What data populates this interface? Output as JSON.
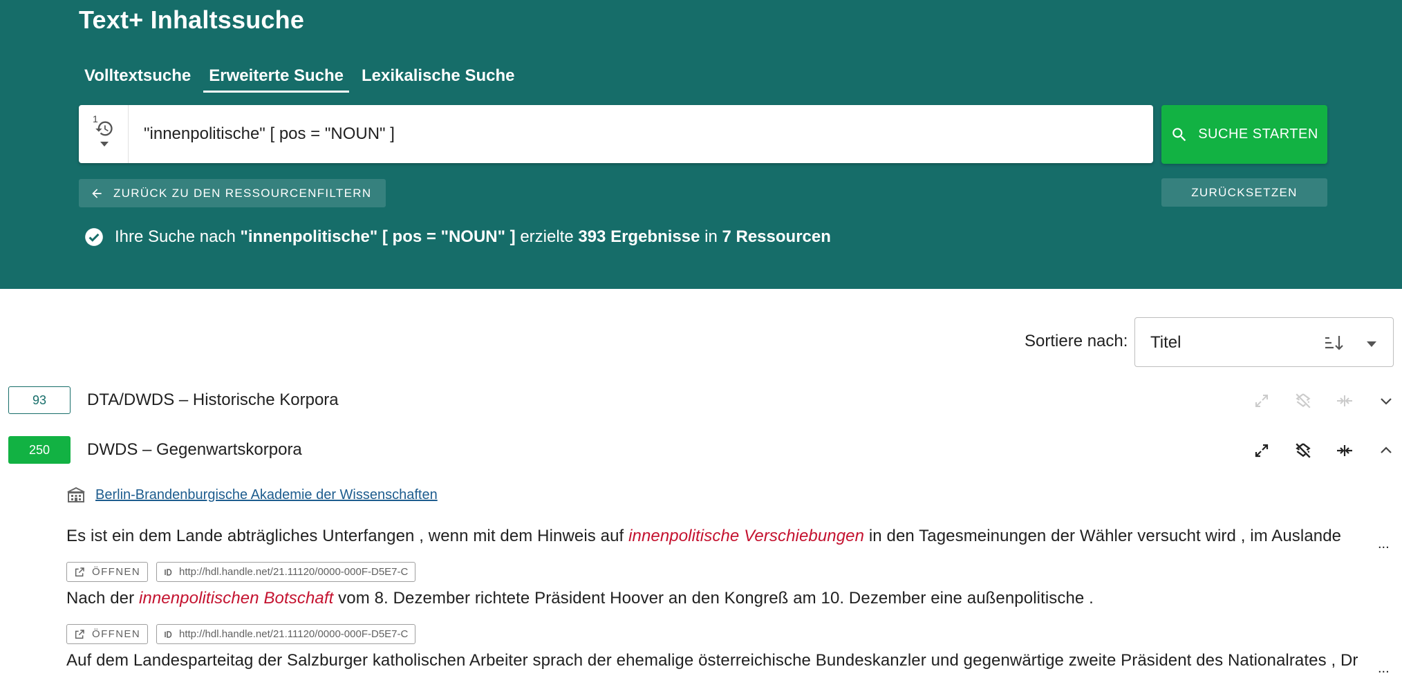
{
  "app": {
    "title": "Text+ Inhaltssuche"
  },
  "tabs": [
    {
      "label": "Volltextsuche",
      "active": false
    },
    {
      "label": "Erweiterte Suche",
      "active": true
    },
    {
      "label": "Lexikalische Suche",
      "active": false
    }
  ],
  "search": {
    "history_count": "1",
    "query": "\"innenpolitische\" [ pos = \"NOUN\" ]",
    "submit_label": "SUCHE STARTEN",
    "back_label": "ZURÜCK ZU DEN RESSOURCENFILTERN",
    "reset_label": "ZURÜCKSETZEN"
  },
  "status": {
    "prefix": "Ihre Suche nach ",
    "query": "\"innenpolitische\" [ pos = \"NOUN\" ]",
    "middle": " erzielte ",
    "count": "393 Ergebnisse",
    "in": " in ",
    "resources": "7 Ressourcen"
  },
  "sort": {
    "label": "Sortiere nach:",
    "value": "Titel"
  },
  "results": [
    {
      "count": "93",
      "title": "DTA/DWDS – Historische Korpora",
      "expanded": false
    },
    {
      "count": "250",
      "title": "DWDS – Gegenwartskorpora",
      "expanded": true
    }
  ],
  "provider": {
    "name": "Berlin-Brandenburgische Akademie der Wissenschaften"
  },
  "kwic": [
    {
      "left": "Es ist ein dem Lande abträgliches Unterfangen , wenn mit dem Hinweis auf ",
      "hit": "innenpolitische Verschiebungen",
      "right": " in den Tagesmeinungen der Wähler versucht wird , im Auslande"
    },
    {
      "left": "Nach der ",
      "hit": "innenpolitischen Botschaft",
      "right": " vom 8. Dezember richtete Präsident Hoover an den Kongreß am 10. Dezember eine außenpolitische ."
    },
    {
      "left": "Auf dem Landesparteitag der Salzburger katholischen Arbeiter sprach der ehemalige österreichische Bundeskanzler und gegenwärtige zweite Präsident des Nationalrates , Dr",
      "hit": "",
      "right": ""
    }
  ],
  "ellipsis": "...",
  "chips": {
    "open_label": "ÖFFNEN",
    "handle_1": "http://hdl.handle.net/21.11120/0000-000F-D5E7-C",
    "handle_2": "http://hdl.handle.net/21.11120/0000-000F-D5E7-C"
  },
  "colors": {
    "header": "#166d69",
    "primary_button": "#12b243",
    "hit": "#c4122f",
    "link": "#1d5c8e"
  }
}
